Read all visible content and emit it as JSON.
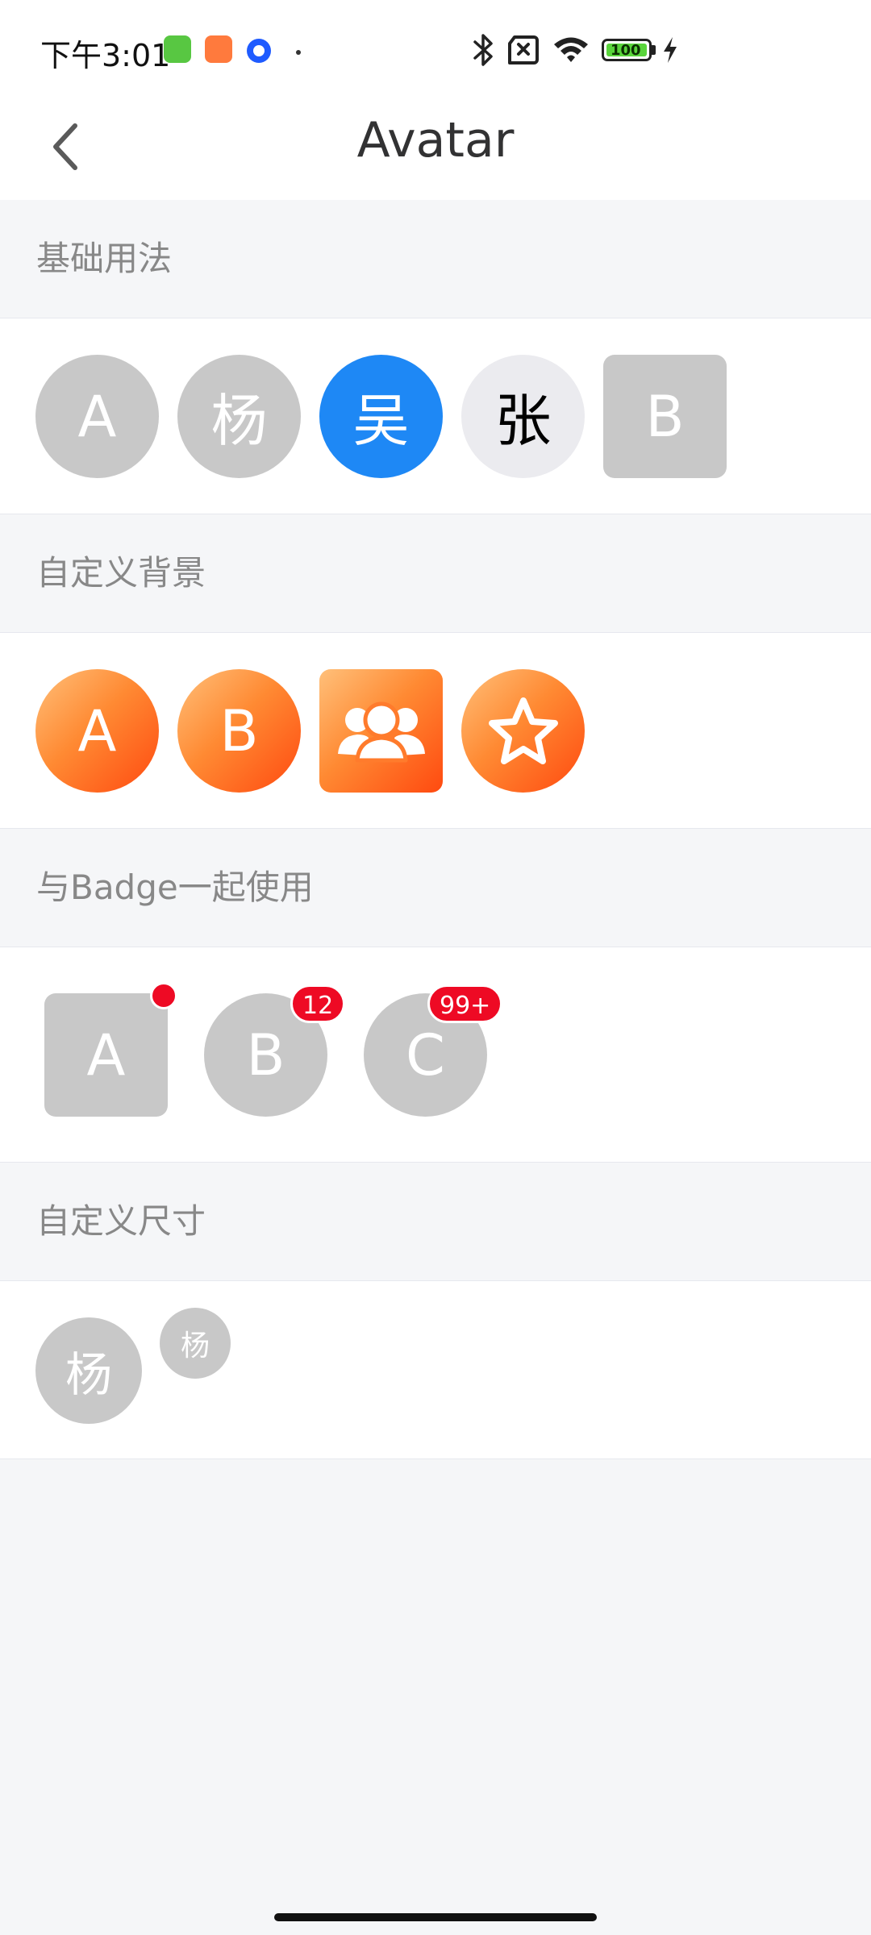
{
  "status_bar": {
    "time": "下午3:01",
    "battery": "100"
  },
  "nav": {
    "title": "Avatar"
  },
  "sections": [
    {
      "title": "基础用法",
      "avatars": [
        "A",
        "杨",
        "吴",
        "张",
        "B"
      ]
    },
    {
      "title": "自定义背景",
      "avatars": [
        "A",
        "B"
      ]
    },
    {
      "title": "与Badge一起使用",
      "avatars": [
        "A",
        "B",
        "C"
      ],
      "badges": [
        "12",
        "99+"
      ]
    },
    {
      "title": "自定义尺寸",
      "avatars": [
        "杨",
        "杨"
      ]
    }
  ],
  "colors": {
    "primary": "#1e88f5",
    "badge": "#ee0a24",
    "avatar_default": "#c8c8c8",
    "avatar_light": "#ebebef",
    "gradient_start": "#ffc07a",
    "gradient_end": "#ff4a10"
  },
  "icons": {
    "back": "chevron-left-icon",
    "group": "people-group-icon",
    "star": "star-icon"
  }
}
